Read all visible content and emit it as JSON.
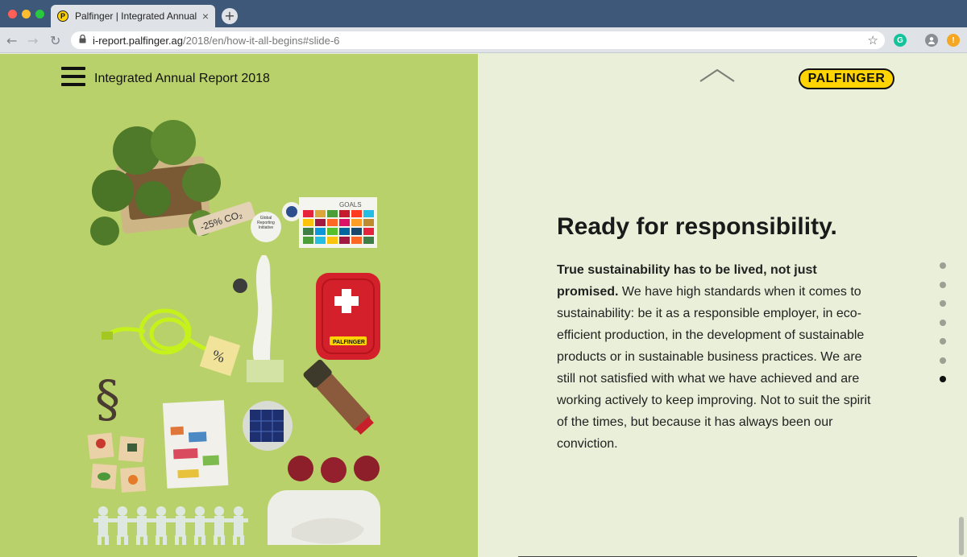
{
  "browser": {
    "tab_title": "Palfinger | Integrated Annual R",
    "tab_close": "×",
    "favicon_letter": "P",
    "new_tab": "+",
    "back": "←",
    "forward": "→",
    "reload": "↻",
    "url_host": "i-report.palfinger.ag",
    "url_path": "/2018/en/how-it-all-begins#slide-6",
    "star": "☆",
    "ext_letter": "G",
    "ext_alert": "!"
  },
  "header": {
    "report_title": "Integrated Annual Report 2018",
    "logo_text": "PALFINGER"
  },
  "illustration": {
    "co2_tag": "-25% CO₂",
    "gri_badge": "Global Reporting Initiative",
    "sdg_card_title": "GOALS",
    "kit_label": "PALFINGER",
    "percent_note": "%",
    "paragraph_sign": "§"
  },
  "content": {
    "headline": "Ready for responsibility.",
    "lead": "True sustainability has to be lived, not just promised.",
    "body": " We have high standards when it comes to sustainability: be it as a responsible employer, in eco-efficient production, in the development of sustainable products or in sustainable business practices. We are still not satisfied with what we have achieved and are working actively to keep improving. Not to suit the spirit of the times, but because it has always been our conviction."
  },
  "pager": {
    "total": 7,
    "active": 7
  },
  "colors": {
    "left_panel": "#b9d16a",
    "right_panel": "#e9efd8",
    "logo_yellow": "#ffd400",
    "chrome_blue": "#3d5879"
  }
}
